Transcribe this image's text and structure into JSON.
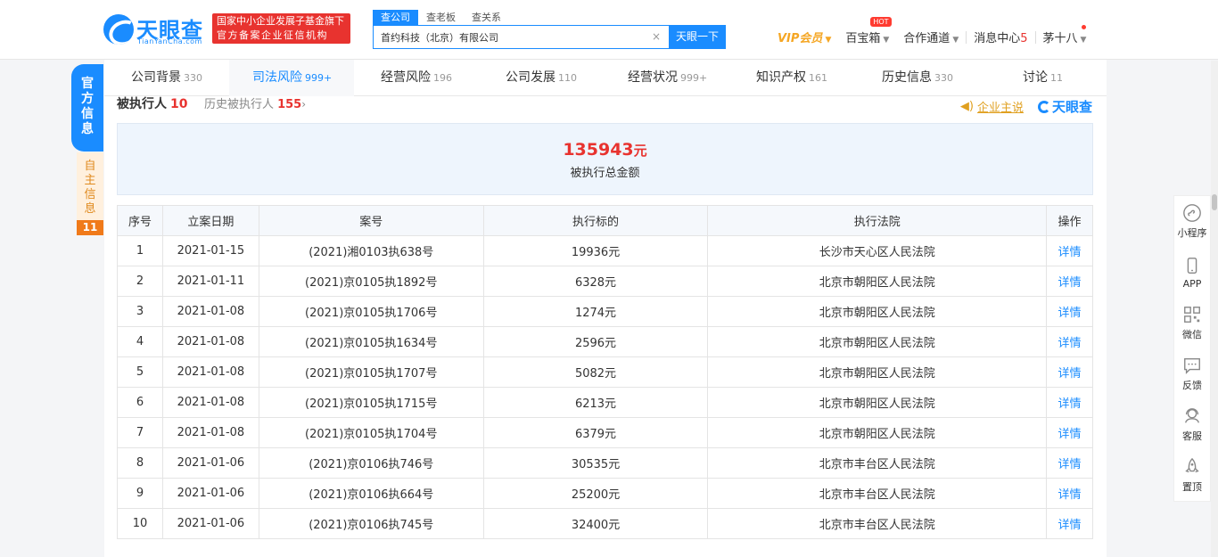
{
  "header": {
    "logo_text": "天眼查",
    "logo_sub": "TianYanCha.com",
    "badge_line1": "国家中小企业发展子基金旗下",
    "badge_line2": "官方备案企业征信机构",
    "search_tabs": [
      "查公司",
      "查老板",
      "查关系"
    ],
    "search_value": "首约科技（北京）有限公司",
    "search_clear": "×",
    "search_button": "天眼一下",
    "nav": {
      "vip": "VIP会员",
      "treasure": "百宝箱",
      "hot": "HOT",
      "channel": "合作通道",
      "messages": "消息中心",
      "messages_count": "5",
      "user": "茅十八"
    }
  },
  "side_tabs": {
    "official": "官方信息",
    "self": "自主信息",
    "self_count": "11"
  },
  "tabs": [
    {
      "label": "公司背景",
      "count": "330"
    },
    {
      "label": "司法风险",
      "count": "999+"
    },
    {
      "label": "经营风险",
      "count": "196"
    },
    {
      "label": "公司发展",
      "count": "110"
    },
    {
      "label": "经营状况",
      "count": "999+"
    },
    {
      "label": "知识产权",
      "count": "161"
    },
    {
      "label": "历史信息",
      "count": "330"
    },
    {
      "label": "讨论",
      "count": "11"
    }
  ],
  "section": {
    "title": "被执行人",
    "count": "10",
    "history_label": "历史被执行人",
    "history_count": "155",
    "history_arrow": "›",
    "speak_label": "企业主说",
    "brand": "天眼查"
  },
  "summary": {
    "amount": "135943",
    "unit": "元",
    "label": "被执行总金额"
  },
  "table": {
    "headers": [
      "序号",
      "立案日期",
      "案号",
      "执行标的",
      "执行法院",
      "操作"
    ],
    "rows": [
      [
        "1",
        "2021-01-15",
        "(2021)湘0103执638号",
        "19936元",
        "长沙市天心区人民法院",
        "详情"
      ],
      [
        "2",
        "2021-01-11",
        "(2021)京0105执1892号",
        "6328元",
        "北京市朝阳区人民法院",
        "详情"
      ],
      [
        "3",
        "2021-01-08",
        "(2021)京0105执1706号",
        "1274元",
        "北京市朝阳区人民法院",
        "详情"
      ],
      [
        "4",
        "2021-01-08",
        "(2021)京0105执1634号",
        "2596元",
        "北京市朝阳区人民法院",
        "详情"
      ],
      [
        "5",
        "2021-01-08",
        "(2021)京0105执1707号",
        "5082元",
        "北京市朝阳区人民法院",
        "详情"
      ],
      [
        "6",
        "2021-01-08",
        "(2021)京0105执1715号",
        "6213元",
        "北京市朝阳区人民法院",
        "详情"
      ],
      [
        "7",
        "2021-01-08",
        "(2021)京0105执1704号",
        "6379元",
        "北京市朝阳区人民法院",
        "详情"
      ],
      [
        "8",
        "2021-01-06",
        "(2021)京0106执746号",
        "30535元",
        "北京市丰台区人民法院",
        "详情"
      ],
      [
        "9",
        "2021-01-06",
        "(2021)京0106执664号",
        "25200元",
        "北京市丰台区人民法院",
        "详情"
      ],
      [
        "10",
        "2021-01-06",
        "(2021)京0106执745号",
        "32400元",
        "北京市丰台区人民法院",
        "详情"
      ]
    ]
  },
  "right_toolbar": [
    {
      "label": "小程序",
      "icon": "mini-program-icon"
    },
    {
      "label": "APP",
      "icon": "phone-icon"
    },
    {
      "label": "微信",
      "icon": "qrcode-icon"
    },
    {
      "label": "反馈",
      "icon": "chat-icon"
    },
    {
      "label": "客服",
      "icon": "headset-icon"
    },
    {
      "label": "置顶",
      "icon": "rocket-icon"
    }
  ],
  "colors": {
    "brand_blue": "#1a8cff",
    "accent_red": "#e8332f",
    "vip_gold": "#f5a623",
    "self_orange": "#f07a1a"
  }
}
